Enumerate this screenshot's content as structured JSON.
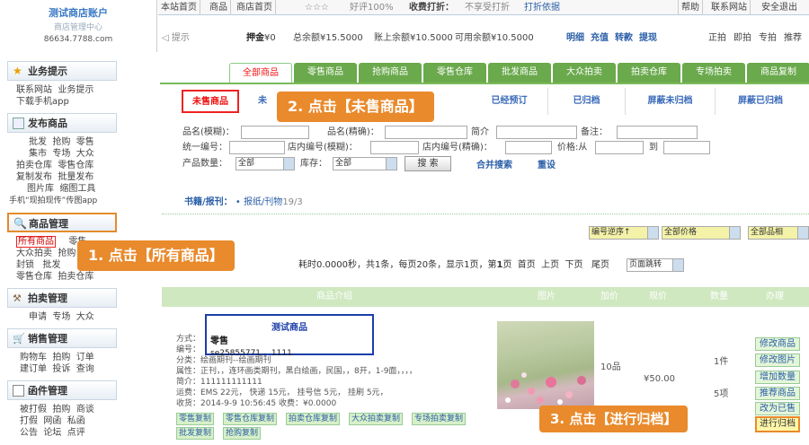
{
  "logo": {
    "title": "测试商店账户",
    "subtitle": "商店管理中心",
    "user": "86634.7788.com"
  },
  "topbar": {
    "items": [
      "本站首页",
      "商品",
      "商店首页"
    ],
    "stars": "☆☆☆",
    "praise": "好评100%",
    "discount_label": "收费打折：",
    "discount_value": "不享受打折",
    "discount_link": "打折依据",
    "right": [
      "帮助",
      "联系网站",
      "安全退出"
    ]
  },
  "bar2": {
    "hint": "提示",
    "deposit_label": "押金",
    "deposit": "¥0",
    "total_label": "总余额",
    "total": "¥15.5000",
    "account_label": "账上余额",
    "account": "¥10.5000",
    "avail_label": "可用余额",
    "avail": "¥10.5000",
    "links": [
      "明细",
      "充值",
      "转款",
      "提现"
    ],
    "right": [
      "正拍",
      "即拍",
      "专拍",
      "推荐"
    ]
  },
  "nav": {
    "s1": {
      "title": "业务提示",
      "links": [
        "联系网站",
        "业务提示",
        "下载手机app"
      ]
    },
    "s2": {
      "title": "发布商品",
      "rows": [
        [
          "批发",
          "抢购",
          "零售"
        ],
        [
          "集市",
          "专场",
          "大众"
        ],
        [
          "拍卖仓库",
          "零售仓库"
        ],
        [
          "复制发布",
          "批量发布"
        ],
        [
          "图片库",
          "缩图工具"
        ],
        [
          "手机“现拍现传”传图app"
        ]
      ]
    },
    "s3": {
      "title": "商品管理",
      "rows": [
        [
          "所有商品",
          "零售"
        ],
        [
          "大众拍卖",
          "抢购"
        ],
        [
          "封锁",
          "批发"
        ],
        [
          "零售仓库",
          "拍卖仓库"
        ]
      ]
    },
    "s4": {
      "title": "拍卖管理",
      "links": [
        "申请",
        "专场",
        "大众"
      ]
    },
    "s5": {
      "title": "销售管理",
      "rows": [
        [
          "购物车",
          "拍购",
          "订单"
        ],
        [
          "建订单",
          "投诉",
          "查询"
        ]
      ]
    },
    "s6": {
      "title": "函件管理",
      "rows": [
        [
          "被打假",
          "拍购",
          "商谈"
        ],
        [
          "打假",
          "网函",
          "私函"
        ],
        [
          "公告",
          "论坛",
          "点评"
        ]
      ]
    }
  },
  "tabs": [
    "全部商品",
    "零售商品",
    "抢购商品",
    "零售仓库",
    "批发商品",
    "大众拍卖",
    "拍卖仓库",
    "专场拍卖",
    "商品复制"
  ],
  "subtabs": [
    "未售商品",
    "未",
    "已经预订",
    "已归档",
    "屏蔽未归档",
    "屏蔽已归档"
  ],
  "form": {
    "name_fuzzy": "品名(模糊)：",
    "name_exact": "品名(精确)：",
    "brief": "简介",
    "remark": "备注：",
    "code": "统一编号：",
    "shopcode": "店内编号(模糊)：",
    "shopcode_exact": "店内编号(精确)：",
    "price": "价格:从",
    "to": "到",
    "qty": "产品数量：",
    "qty_val": "全部",
    "stock": "库存：",
    "stock_val": "全部",
    "search": "搜 索",
    "merge": "合并搜索",
    "reset": "重设"
  },
  "category": {
    "label": "书籍/报刊：",
    "path": "报纸/刊物",
    "count": "19/3"
  },
  "sort": {
    "order": "编号逆序↑",
    "price": "全部价格",
    "category": "全部品相"
  },
  "paging": {
    "text": "耗时0.0000秒，共1条，每页20条，显示1页，第",
    "page": "1",
    "page_suffix": "页",
    "links": [
      "首页",
      "上页",
      "下页",
      "尾页"
    ],
    "jump": "页面跳转"
  },
  "thead": [
    "商品介绍",
    "图片",
    "加价",
    "现价",
    "数量",
    "办理"
  ],
  "product": {
    "title": "测试商品",
    "type": "零售",
    "code_line": "se25855771 ，1111",
    "mode_label": "方式：",
    "code_label": "编号：",
    "category": "分类：绘画期刊--绘画期刊",
    "attrs": "属性：正刊，，连环画类期刊，黑白绘画，民国，，8开，1-9面，，，，",
    "brief": "简介：111111111111",
    "shipping": "运费：EMS 22元， 快递 15元， 挂号信 5元， 挂刷 5元，",
    "received": "收货：2014-9-9 10:56:45  收费：¥0.0000",
    "markup": "10品",
    "price": "¥50.00",
    "qty": "1件",
    "qty2": "5项",
    "copy_buttons": [
      "零售复制",
      "零售仓库复制",
      "拍卖仓库复制",
      "大众拍卖复制",
      "专场拍卖复制",
      "批发复制",
      "抢购复制"
    ],
    "actions": [
      "修改商品",
      "修改图片",
      "增加数量",
      "推荐商品",
      "改为已售",
      "进行归档"
    ]
  },
  "callouts": {
    "c1": "1. 点击【所有商品】",
    "c2": "2. 点击【未售商品】",
    "c3": "3. 点击【进行归档】"
  },
  "colors": {
    "accent": "#e98a2c",
    "tab_green": "#6aa94c",
    "link_blue": "#2a5fa8",
    "alert_red": "#e11"
  }
}
